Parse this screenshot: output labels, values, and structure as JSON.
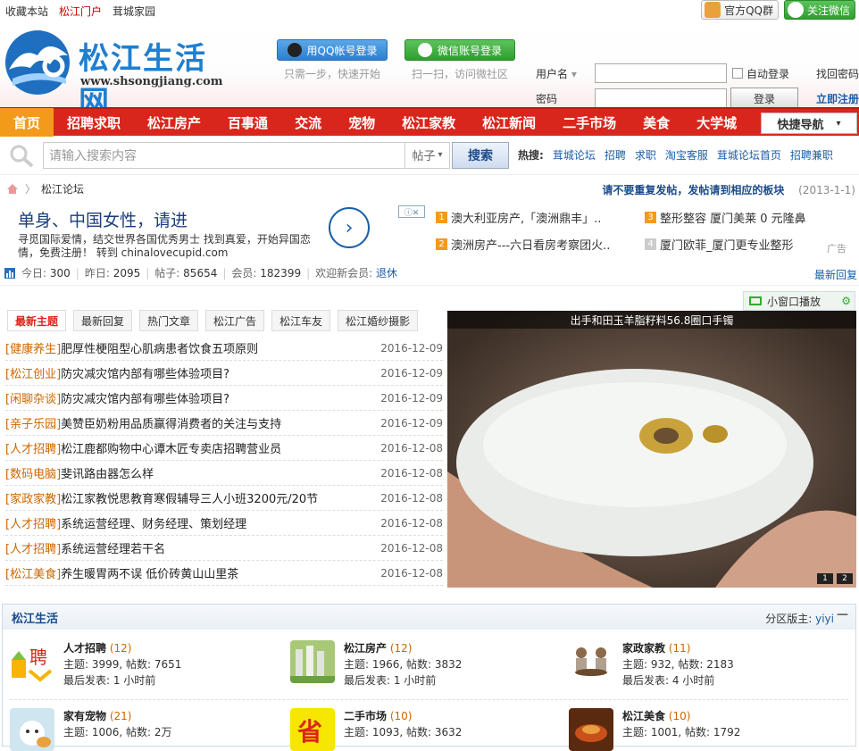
{
  "topbar": {
    "bookmark": "收藏本站",
    "portal": "松江门户",
    "home": "茸城家园",
    "qq_group": "官方QQ群",
    "wechat": "关注微信"
  },
  "header": {
    "logo_text": "松江生活网",
    "logo_url": "www.shsongjiang.com",
    "qq_login": "用QQ帐号登录",
    "qq_hint": "只需一步，快速开始",
    "wx_login": "微信账号登录",
    "wx_hint": "扫一扫，访问微社区",
    "username_label": "用户名",
    "password_label": "密码",
    "auto_login": "自动登录",
    "login_btn": "登录",
    "forgot": "找回密码",
    "register": "立即注册"
  },
  "nav": {
    "items": [
      "首页",
      "招聘求职",
      "松江房产",
      "百事通",
      "交流",
      "宠物",
      "松江家教",
      "松江新闻",
      "二手市场",
      "美食",
      "大学城"
    ],
    "quick": "快捷导航"
  },
  "search": {
    "placeholder": "请输入搜索内容",
    "type": "帖子",
    "button": "搜索",
    "hot_label": "热搜:",
    "hot": [
      "茸城论坛",
      "招聘",
      "求职",
      "淘宝客服",
      "茸城论坛首页",
      "招聘兼职"
    ]
  },
  "crumb": {
    "current": "松江论坛",
    "notice": "请不要重复发帖，发帖请到相应的板块",
    "date": "(2013-1-1)"
  },
  "ad": {
    "headline": "单身、中国女性，请进",
    "desc": "寻觅国际爱情，结交世界各国优秀男士 找到真爱，开始异国恋情，免费注册！ 转到 chinalovecupid.com",
    "ads": [
      "澳大利亚房产,「澳洲鼎丰」..",
      "整形整容 厦门美莱 0 元隆鼻",
      "澳洲房产---六日看房考察团火..",
      "厦门欧菲_厦门更专业整形"
    ],
    "ad_label": "广告"
  },
  "stats": {
    "today_label": "今日:",
    "today": "300",
    "yesterday_label": "昨日:",
    "yesterday": "2095",
    "posts_label": "帖子:",
    "posts": "85654",
    "members_label": "会员:",
    "members": "182399",
    "welcome": "欢迎新会员:",
    "newmember": "退休",
    "latest": "最新回复",
    "smallwin": "小窗口播放"
  },
  "tabs": [
    "最新主题",
    "最新回复",
    "热门文章",
    "松江广告",
    "松江车友",
    "松江婚纱摄影"
  ],
  "threads": [
    {
      "cat": "[健康养生]",
      "title": "肥厚性梗阻型心肌病患者饮食五项原则",
      "date": "2016-12-09"
    },
    {
      "cat": "[松江创业]",
      "title": "防灾减灾馆内部有哪些体验项目?",
      "date": "2016-12-09"
    },
    {
      "cat": "[闲聊杂谈]",
      "title": "防灾减灾馆内部有哪些体验项目?",
      "date": "2016-12-09"
    },
    {
      "cat": "[亲子乐园]",
      "title": "美赞臣奶粉用品质赢得消费者的关注与支持",
      "date": "2016-12-09"
    },
    {
      "cat": "[人才招聘]",
      "title": "松江鹿都购物中心谭木匠专卖店招聘营业员",
      "date": "2016-12-08"
    },
    {
      "cat": "[数码电脑]",
      "title": "斐讯路由器怎么样",
      "date": "2016-12-08"
    },
    {
      "cat": "[家政家教]",
      "title": "松江家教悦思教育寒假辅导三人小班3200元/20节",
      "date": "2016-12-08"
    },
    {
      "cat": "[人才招聘]",
      "title": "系统运营经理、财务经理、策划经理",
      "date": "2016-12-08"
    },
    {
      "cat": "[人才招聘]",
      "title": "系统运营经理若干名",
      "date": "2016-12-08"
    },
    {
      "cat": "[松江美食]",
      "title": "养生暖胃两不误 低价砖黄山山里茶",
      "date": "2016-12-08"
    }
  ],
  "slide": {
    "caption": "出手和田玉羊脂籽料56.8圈口手镯",
    "pages": [
      "1",
      "2"
    ]
  },
  "section": {
    "title": "松江生活",
    "mod_label": "分区版主:",
    "mod": "yiyi",
    "forums": [
      {
        "name": "人才招聘",
        "count": "(12)",
        "stats": "主题: 3999, 帖数: 7651",
        "last": "最后发表: 1 小时前"
      },
      {
        "name": "松江房产",
        "count": "(12)",
        "stats": "主题: 1966, 帖数: 3832",
        "last": "最后发表: 1 小时前"
      },
      {
        "name": "家政家教",
        "count": "(11)",
        "stats": "主题: 932, 帖数: 2183",
        "last": "最后发表: 4 小时前"
      },
      {
        "name": "家有宠物",
        "count": "(21)",
        "stats": "主题: 1006, 帖数: 2万",
        "last": ""
      },
      {
        "name": "二手市场",
        "count": "(10)",
        "stats": "主题: 1093, 帖数: 3632",
        "last": ""
      },
      {
        "name": "松江美食",
        "count": "(10)",
        "stats": "主题: 1001, 帖数: 1792",
        "last": ""
      }
    ]
  },
  "colors": {
    "nav_red": "#d9261c",
    "nav_active": "#f39a1b",
    "link_blue": "#1a5ea8"
  }
}
